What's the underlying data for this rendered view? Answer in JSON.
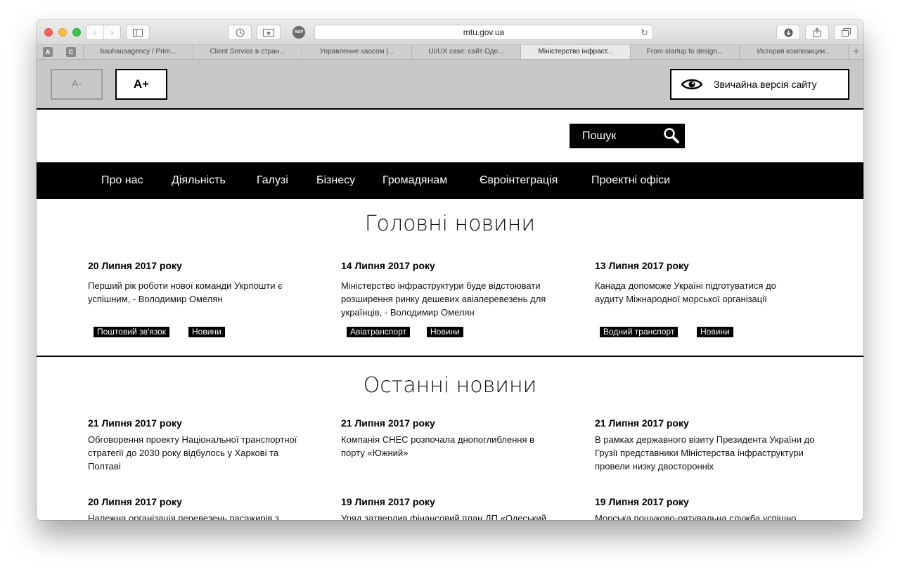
{
  "browser": {
    "url": "mtu.gov.ua",
    "pinned_tabs": [
      "A",
      "C"
    ],
    "tabs": [
      "bauhausagency / Prim...",
      "Client Service в стран...",
      "Управление хаосом |...",
      "UI/UX case: сайт Оде...",
      "Міністерство інфраст...",
      "From startup to design...",
      "История композиции..."
    ],
    "abp_label": "ABP",
    "new_tab": "+"
  },
  "accessibility": {
    "font_smaller": "A-",
    "font_larger": "A+",
    "normal_version": "Звичайна версія сайту"
  },
  "search": {
    "placeholder": "Пошук"
  },
  "nav": [
    "Про нас",
    "Діяльність",
    "Галузі",
    "Бізнесу",
    "Громадянам",
    "Євроінтеграція",
    "Проектні офіси"
  ],
  "main_news": {
    "title": "Головні новини",
    "items": [
      {
        "date": "20 Липня 2017 року",
        "text": "Перший рік роботи нової команди Укрпошти є успішним, - Володимир Омелян",
        "tags": [
          "Поштовий зв'язок",
          "Новини"
        ]
      },
      {
        "date": "14 Липня 2017 року",
        "text": "Міністерство інфраструктури буде відстоювати розширення ринку дешевих авіаперевезень для українців, - Володимир Омелян",
        "tags": [
          "Авіатранспорт",
          "Новини"
        ]
      },
      {
        "date": "13 Липня 2017 року",
        "text": "Канада допоможе Україні підготуватися до аудиту Міжнародної морської організації",
        "tags": [
          "Водний транспорт",
          "Новини"
        ]
      }
    ]
  },
  "latest_news": {
    "title": "Останні новини",
    "items": [
      {
        "date": "21 Липня 2017 року",
        "text": "Обговорення проекту Національної транспортної стратегії до 2030 року відбулось у Харкові та Полтаві"
      },
      {
        "date": "21 Липня 2017 року",
        "text": "Компанія CHEC розпочала днопоглиблення в порту «Южний»"
      },
      {
        "date": "21 Липня 2017 року",
        "text": "В рамках державного візиту Президента України до Грузії представники Міністерства інфраструктури провели низку двосторонніх"
      },
      {
        "date": "20 Липня 2017 року",
        "text": "Належна організація перевезень пасажирів з"
      },
      {
        "date": "19 Липня 2017 року",
        "text": "Уряд затвердив фінансовий план ДП «Одеський"
      },
      {
        "date": "19 Липня 2017 року",
        "text": "Морська пошуково-рятувальна служба успішно"
      }
    ]
  }
}
